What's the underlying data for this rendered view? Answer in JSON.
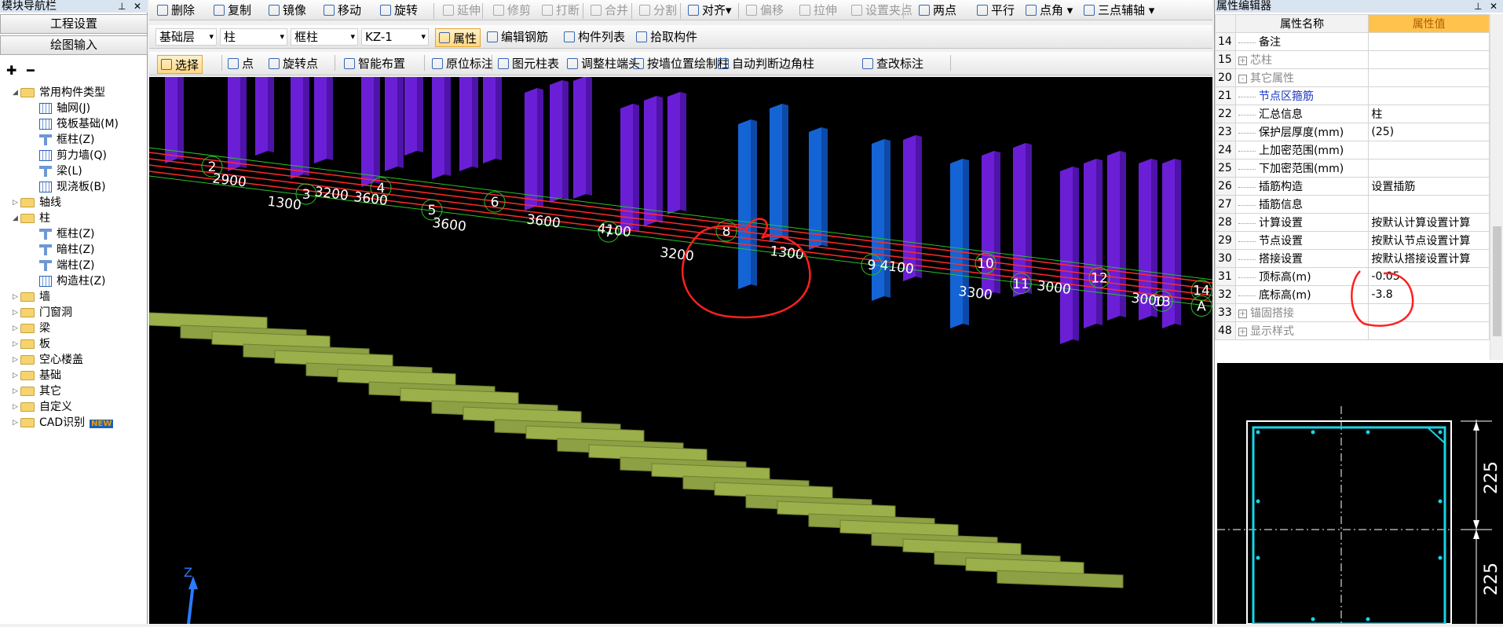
{
  "nav": {
    "title": "模块导航栏",
    "project_settings": "工程设置",
    "drawing_input": "绘图输入",
    "tree": [
      {
        "label": "常用构件类型",
        "indent": 0,
        "kind": "folder",
        "open": true
      },
      {
        "label": "轴网(J)",
        "indent": 1,
        "kind": "item"
      },
      {
        "label": "筏板基础(M)",
        "indent": 1,
        "kind": "item"
      },
      {
        "label": "框柱(Z)",
        "indent": 1,
        "kind": "col"
      },
      {
        "label": "剪力墙(Q)",
        "indent": 1,
        "kind": "item"
      },
      {
        "label": "梁(L)",
        "indent": 1,
        "kind": "col"
      },
      {
        "label": "现浇板(B)",
        "indent": 1,
        "kind": "item"
      },
      {
        "label": "轴线",
        "indent": 0,
        "kind": "folder"
      },
      {
        "label": "柱",
        "indent": 0,
        "kind": "folder",
        "open": true
      },
      {
        "label": "框柱(Z)",
        "indent": 1,
        "kind": "col"
      },
      {
        "label": "暗柱(Z)",
        "indent": 1,
        "kind": "col"
      },
      {
        "label": "端柱(Z)",
        "indent": 1,
        "kind": "col"
      },
      {
        "label": "构造柱(Z)",
        "indent": 1,
        "kind": "item"
      },
      {
        "label": "墙",
        "indent": 0,
        "kind": "folder"
      },
      {
        "label": "门窗洞",
        "indent": 0,
        "kind": "folder"
      },
      {
        "label": "梁",
        "indent": 0,
        "kind": "folder"
      },
      {
        "label": "板",
        "indent": 0,
        "kind": "folder"
      },
      {
        "label": "空心楼盖",
        "indent": 0,
        "kind": "folder"
      },
      {
        "label": "基础",
        "indent": 0,
        "kind": "folder"
      },
      {
        "label": "其它",
        "indent": 0,
        "kind": "folder"
      },
      {
        "label": "自定义",
        "indent": 0,
        "kind": "folder"
      },
      {
        "label": "CAD识别",
        "indent": 0,
        "kind": "folder",
        "badge": "NEW"
      }
    ]
  },
  "toolbar1": [
    {
      "label": "删除"
    },
    {
      "label": "复制"
    },
    {
      "label": "镜像"
    },
    {
      "label": "移动"
    },
    {
      "label": "旋转"
    },
    {
      "label": "延伸",
      "disabled": true
    },
    {
      "label": "修剪",
      "disabled": true
    },
    {
      "label": "打断",
      "disabled": true
    },
    {
      "label": "合并",
      "disabled": true
    },
    {
      "label": "分割",
      "disabled": true
    },
    {
      "label": "对齐▾"
    },
    {
      "label": "偏移",
      "disabled": true
    },
    {
      "label": "拉伸",
      "disabled": true
    },
    {
      "label": "设置夹点",
      "disabled": true
    },
    {
      "label": "两点"
    },
    {
      "label": "平行"
    },
    {
      "label": "点角 ▾"
    },
    {
      "label": "三点辅轴 ▾"
    }
  ],
  "toolbar2": {
    "combos": [
      "基础层",
      "柱",
      "框柱",
      "KZ-1"
    ],
    "buttons": [
      "属性",
      "编辑钢筋",
      "构件列表",
      "拾取构件"
    ]
  },
  "toolbar3": [
    "选择",
    "点",
    "旋转点",
    "智能布置",
    "原位标注",
    "图元柱表",
    "调整柱端头",
    "按墙位置绘制柱",
    "自动判断边角柱",
    "查改标注"
  ],
  "viewport": {
    "axis_label": "Z",
    "grid_numbers": [
      "2",
      "3",
      "4",
      "5",
      "6",
      "7",
      "8",
      "9",
      "10",
      "11",
      "12",
      "13",
      "14",
      "A"
    ],
    "dims": [
      "2900",
      "1300",
      "3200",
      "3600",
      "3600",
      "3600",
      "4100",
      "3200",
      "1300",
      "4100",
      "3300",
      "3000",
      "3000"
    ]
  },
  "props": {
    "title": "属性编辑器",
    "head_name": "属性名称",
    "head_value": "属性值",
    "rows": [
      {
        "no": "14",
        "name": "备注",
        "value": "",
        "style": "",
        "pm": ""
      },
      {
        "no": "15",
        "name": "芯柱",
        "value": "",
        "style": "gray",
        "pm": "+"
      },
      {
        "no": "20",
        "name": "其它属性",
        "value": "",
        "style": "gray",
        "pm": "-"
      },
      {
        "no": "21",
        "name": "节点区箍筋",
        "value": "",
        "style": "blue",
        "pm": ""
      },
      {
        "no": "22",
        "name": "汇总信息",
        "value": "柱",
        "style": "",
        "pm": ""
      },
      {
        "no": "23",
        "name": "保护层厚度(mm)",
        "value": "(25)",
        "style": "",
        "pm": ""
      },
      {
        "no": "24",
        "name": "上加密范围(mm)",
        "value": "",
        "style": "",
        "pm": ""
      },
      {
        "no": "25",
        "name": "下加密范围(mm)",
        "value": "",
        "style": "",
        "pm": ""
      },
      {
        "no": "26",
        "name": "插筋构造",
        "value": "设置插筋",
        "style": "",
        "pm": ""
      },
      {
        "no": "27",
        "name": "插筋信息",
        "value": "",
        "style": "",
        "pm": ""
      },
      {
        "no": "28",
        "name": "计算设置",
        "value": "按默认计算设置计算",
        "style": "",
        "pm": ""
      },
      {
        "no": "29",
        "name": "节点设置",
        "value": "按默认节点设置计算",
        "style": "",
        "pm": ""
      },
      {
        "no": "30",
        "name": "搭接设置",
        "value": "按默认搭接设置计算",
        "style": "",
        "pm": ""
      },
      {
        "no": "31",
        "name": "顶标高(m)",
        "value": "-0.05",
        "style": "",
        "pm": ""
      },
      {
        "no": "32",
        "name": "底标高(m)",
        "value": "-3.8",
        "style": "",
        "pm": ""
      },
      {
        "no": "33",
        "name": "锚固搭接",
        "value": "",
        "style": "gray",
        "pm": "+"
      },
      {
        "no": "48",
        "name": "显示样式",
        "value": "",
        "style": "gray",
        "pm": "+"
      }
    ]
  },
  "preview": {
    "dim_top": "225",
    "dim_bottom": "225"
  },
  "colors": {
    "accent": "#ffc34d",
    "viewport_bg": "#000000",
    "axis_red": "#ff2a2a",
    "column_purple": "#6a1fd6",
    "column_blue": "#1464d6",
    "slab_green": "#9bb04a",
    "rebar_cyan": "#1ad3e6"
  }
}
